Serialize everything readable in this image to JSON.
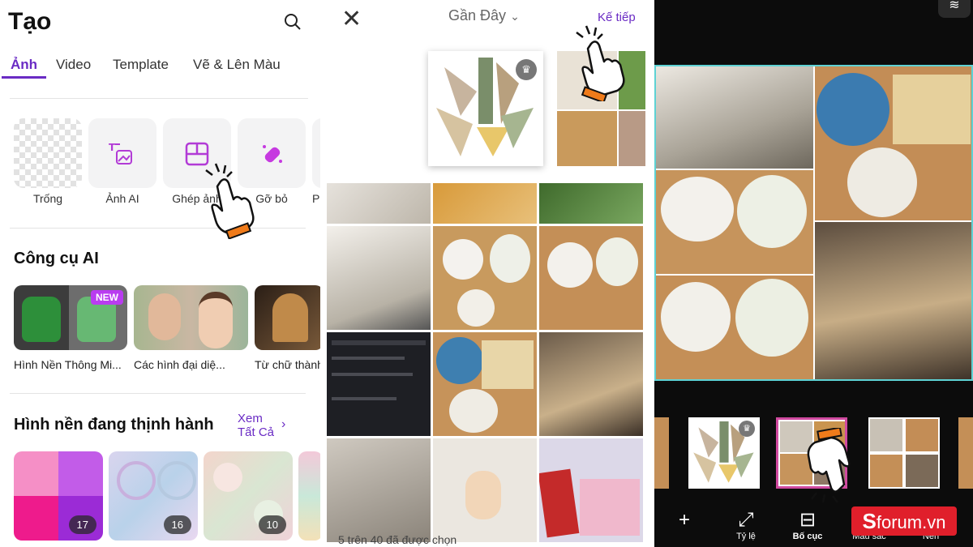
{
  "panel1": {
    "title": "Tạo",
    "tabs": [
      "Ảnh",
      "Video",
      "Template",
      "Vẽ & Lên Màu"
    ],
    "tools": [
      "Trống",
      "Ảnh AI",
      "Ghép ảnh",
      "Gỡ bỏ",
      "P"
    ],
    "ai_section": {
      "title": "Công cụ AI",
      "badge": "NEW",
      "cards": [
        "Hình Nền Thông Mi...",
        "Các hình đại diệ...",
        "Từ chữ thành"
      ]
    },
    "trending": {
      "title": "Hình nền đang thịnh hành",
      "see_all_line1": "Xem",
      "see_all_line2": "Tất Cả",
      "counts": [
        "17",
        "16",
        "10"
      ]
    }
  },
  "panel2": {
    "close": "✕",
    "title": "Gần Đây",
    "next": "Kế tiếp",
    "footer": "5 trên 40 đã được chọn"
  },
  "panel3": {
    "tools": [
      {
        "label": "",
        "icon": "plus-icon"
      },
      {
        "label": "Tỷ lệ",
        "icon": "aspect-ratio-icon"
      },
      {
        "label": "Bố cục",
        "icon": "layout-icon"
      },
      {
        "label": "Màu sắc",
        "icon": "color-icon"
      },
      {
        "label": "Nền",
        "icon": "background-icon"
      }
    ],
    "watermark": "forum.vn",
    "watermark_prefix": "S"
  },
  "colors": {
    "accent": "#6a2bc4",
    "selection": "#d04aa0",
    "canvas_border": "#5ed2d4",
    "watermark": "#e01f2b"
  }
}
